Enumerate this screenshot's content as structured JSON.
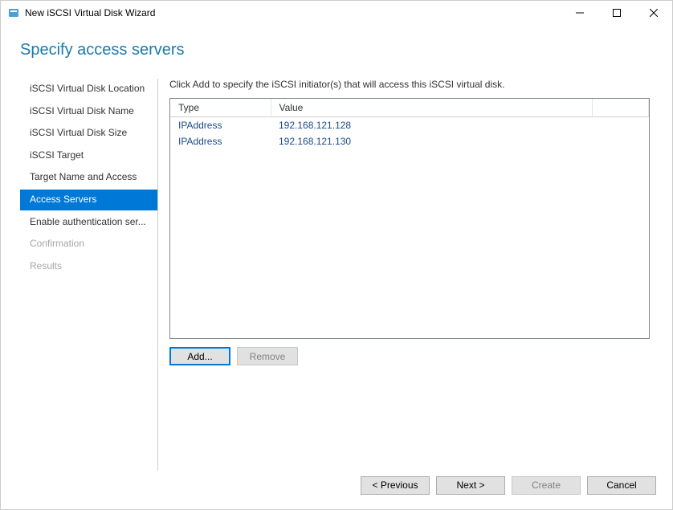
{
  "window": {
    "title": "New iSCSI Virtual Disk Wizard"
  },
  "page": {
    "heading": "Specify access servers",
    "instruction": "Click Add to specify the iSCSI initiator(s) that will access this iSCSI virtual disk."
  },
  "nav": {
    "items": [
      {
        "label": "iSCSI Virtual Disk Location",
        "state": "normal"
      },
      {
        "label": "iSCSI Virtual Disk Name",
        "state": "normal"
      },
      {
        "label": "iSCSI Virtual Disk Size",
        "state": "normal"
      },
      {
        "label": "iSCSI Target",
        "state": "normal"
      },
      {
        "label": "Target Name and Access",
        "state": "normal"
      },
      {
        "label": "Access Servers",
        "state": "active"
      },
      {
        "label": "Enable authentication ser...",
        "state": "normal"
      },
      {
        "label": "Confirmation",
        "state": "disabled"
      },
      {
        "label": "Results",
        "state": "disabled"
      }
    ]
  },
  "table": {
    "headers": {
      "type": "Type",
      "value": "Value"
    },
    "rows": [
      {
        "type": "IPAddress",
        "value": "192.168.121.128"
      },
      {
        "type": "IPAddress",
        "value": "192.168.121.130"
      }
    ]
  },
  "buttons": {
    "add": "Add...",
    "remove": "Remove",
    "previous": "< Previous",
    "next": "Next >",
    "create": "Create",
    "cancel": "Cancel"
  }
}
